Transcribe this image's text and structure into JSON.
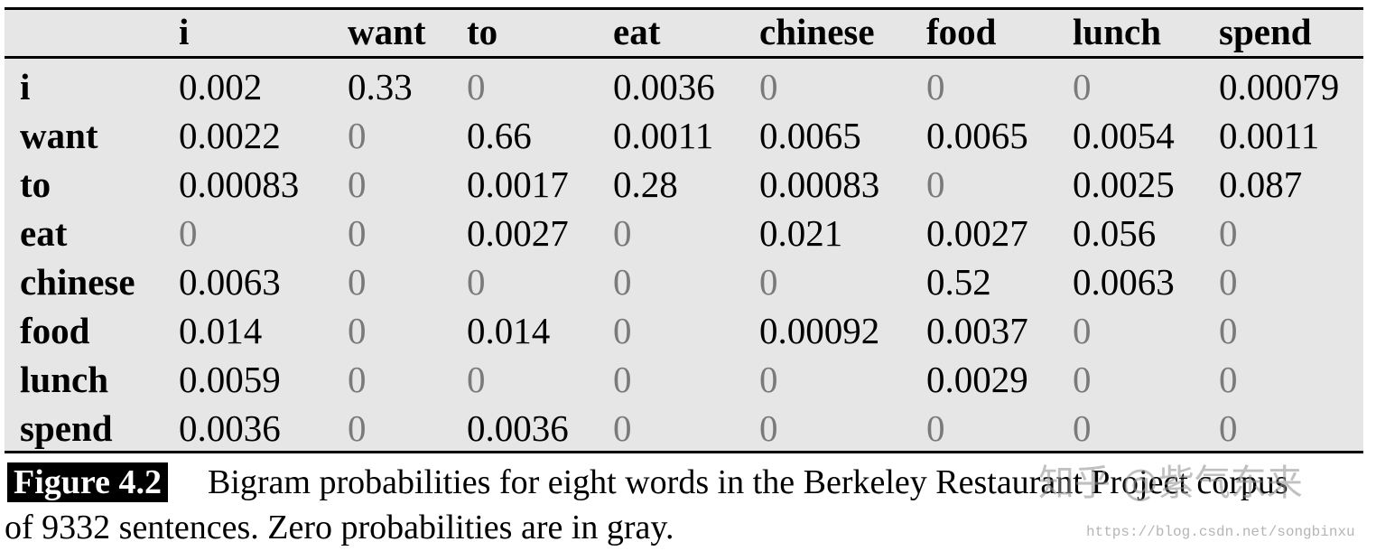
{
  "table": {
    "columns": [
      "i",
      "want",
      "to",
      "eat",
      "chinese",
      "food",
      "lunch",
      "spend"
    ],
    "rows": [
      {
        "label": "i",
        "values": [
          "0.002",
          "0.33",
          "0",
          "0.0036",
          "0",
          "0",
          "0",
          "0.00079"
        ]
      },
      {
        "label": "want",
        "values": [
          "0.0022",
          "0",
          "0.66",
          "0.0011",
          "0.0065",
          "0.0065",
          "0.0054",
          "0.0011"
        ]
      },
      {
        "label": "to",
        "values": [
          "0.00083",
          "0",
          "0.0017",
          "0.28",
          "0.00083",
          "0",
          "0.0025",
          "0.087"
        ]
      },
      {
        "label": "eat",
        "values": [
          "0",
          "0",
          "0.0027",
          "0",
          "0.021",
          "0.0027",
          "0.056",
          "0"
        ]
      },
      {
        "label": "chinese",
        "values": [
          "0.0063",
          "0",
          "0",
          "0",
          "0",
          "0.52",
          "0.0063",
          "0"
        ]
      },
      {
        "label": "food",
        "values": [
          "0.014",
          "0",
          "0.014",
          "0",
          "0.00092",
          "0.0037",
          "0",
          "0"
        ]
      },
      {
        "label": "lunch",
        "values": [
          "0.0059",
          "0",
          "0",
          "0",
          "0",
          "0.0029",
          "0",
          "0"
        ]
      },
      {
        "label": "spend",
        "values": [
          "0.0036",
          "0",
          "0.0036",
          "0",
          "0",
          "0",
          "0",
          "0"
        ]
      }
    ],
    "zero_color": "#7a7a7a",
    "background": "#e6e6e6"
  },
  "caption": {
    "label": "Figure 4.2",
    "line1": "Bigram probabilities for eight words in the Berkeley Restaurant  Project corpus",
    "line2": "of 9332 sentences. Zero probabilities are in gray."
  },
  "watermark": {
    "site": "知乎 @紫气东来",
    "url": "https://blog.csdn.net/songbinxu"
  }
}
